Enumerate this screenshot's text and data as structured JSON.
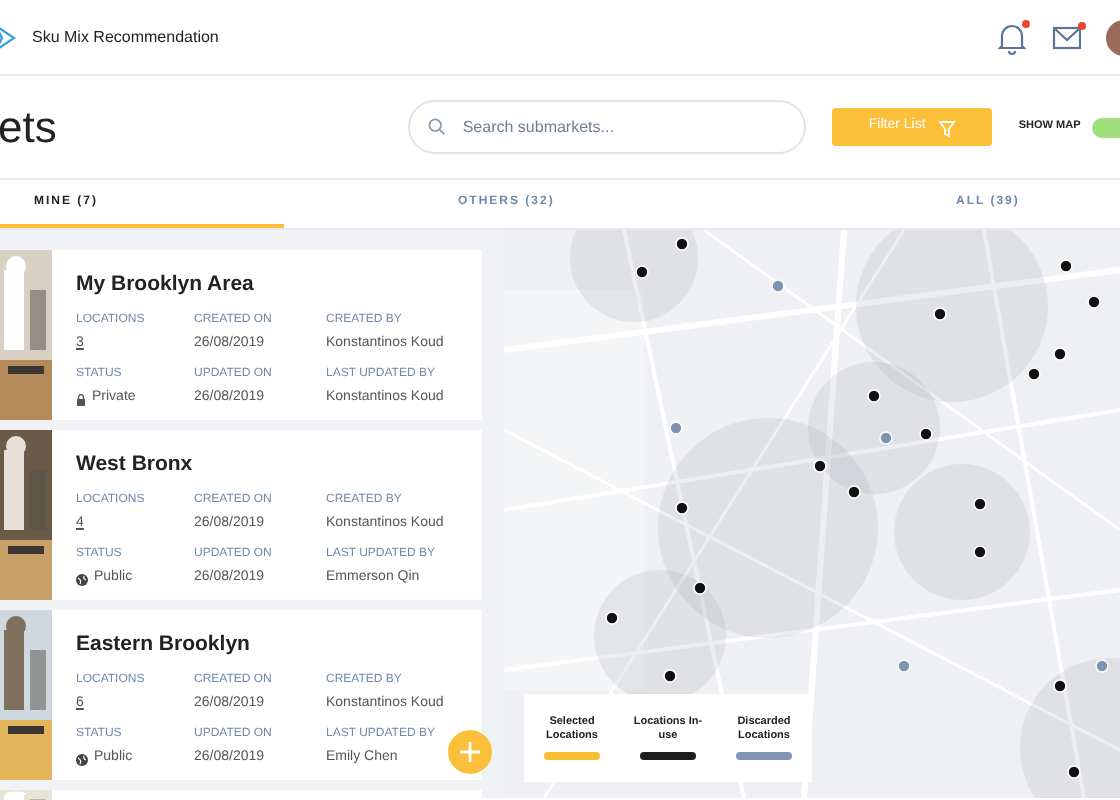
{
  "app": {
    "title": "Sku Mix Recommendation",
    "notifications_unread": true,
    "messages_unread": true
  },
  "page": {
    "title_fragment": "ets",
    "search": {
      "placeholder": "Search submarkets..."
    },
    "filter_button": "Filter List",
    "show_map": {
      "label": "SHOW MAP",
      "on": true
    }
  },
  "tabs": [
    {
      "label": "MINE (7)",
      "selected": true
    },
    {
      "label": "OTHERS (32)",
      "selected": false
    },
    {
      "label": "ALL (39)",
      "selected": false
    }
  ],
  "cards": [
    {
      "name": "My Brooklyn Area",
      "locations_label": "LOCATIONS",
      "locations": "3",
      "created_on_label": "CREATED ON",
      "created_on": "26/08/2019",
      "created_by_label": "CREATED BY",
      "created_by": "Konstantinos Koud",
      "status_label": "STATUS",
      "status": {
        "text": "Private",
        "kind": "private"
      },
      "updated_on_label": "UPDATED ON",
      "updated_on": "26/08/2019",
      "last_updated_by_label": "LAST UPDATED BY",
      "last_updated_by": "Konstantinos Koud"
    },
    {
      "name": "West Bronx",
      "locations_label": "LOCATIONS",
      "locations": "4",
      "created_on_label": "CREATED ON",
      "created_on": "26/08/2019",
      "created_by_label": "CREATED BY",
      "created_by": "Konstantinos Koud",
      "status_label": "STATUS",
      "status": {
        "text": "Public",
        "kind": "public"
      },
      "updated_on_label": "UPDATED ON",
      "updated_on": "26/08/2019",
      "last_updated_by_label": "LAST UPDATED BY",
      "last_updated_by": "Emmerson Qin"
    },
    {
      "name": "Eastern Brooklyn",
      "locations_label": "LOCATIONS",
      "locations": "6",
      "created_on_label": "CREATED ON",
      "created_on": "26/08/2019",
      "created_by_label": "CREATED BY",
      "created_by": "Konstantinos Koud",
      "status_label": "STATUS",
      "status": {
        "text": "Public",
        "kind": "public"
      },
      "updated_on_label": "UPDATED ON",
      "updated_on": "26/08/2019",
      "last_updated_by_label": "LAST UPDATED BY",
      "last_updated_by": "Emily Chen"
    }
  ],
  "legend": [
    {
      "label": "Selected Locations",
      "color": "#f9c034"
    },
    {
      "label": "Locations In-use",
      "color": "#1f1f1f"
    },
    {
      "label": "Discarded Locations",
      "color": "#7f94b0"
    }
  ]
}
